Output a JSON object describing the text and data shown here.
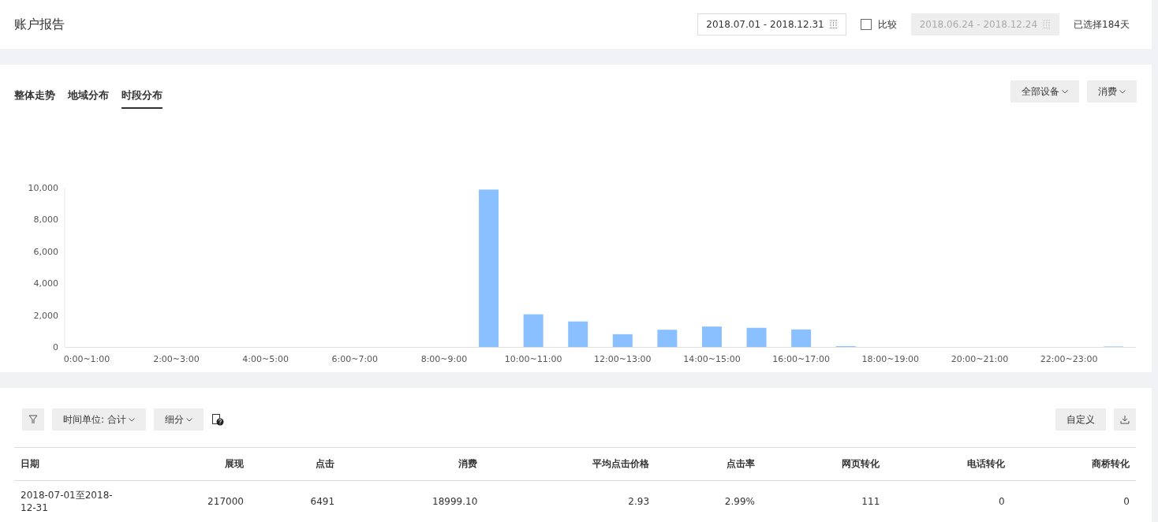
{
  "header": {
    "title": "账户报告",
    "date_range": "2018.07.01 - 2018.12.31",
    "compare": {
      "label": "比较",
      "checked": false
    },
    "compare_range": "2018.06.24 - 2018.12.24",
    "compare_disabled": true,
    "selected_days": "已选择184天"
  },
  "tabs": [
    {
      "label": "整体走势",
      "selected": false
    },
    {
      "label": "地域分布",
      "selected": false
    },
    {
      "label": "时段分布",
      "selected": true
    }
  ],
  "chart_filters": [
    "全部设备",
    "消费"
  ],
  "chart_data": {
    "type": "bar",
    "categories": [
      "0:00~1:00",
      null,
      "2:00~3:00",
      null,
      "4:00~5:00",
      null,
      "6:00~7:00",
      null,
      "8:00~9:00",
      null,
      "10:00~11:00",
      null,
      "12:00~13:00",
      null,
      "14:00~15:00",
      null,
      "16:00~17:00",
      null,
      "18:00~19:00",
      null,
      "20:00~21:00",
      null,
      "22:00~23:00",
      null
    ],
    "values": [
      0,
      0,
      0,
      0,
      0,
      0,
      0,
      0,
      0,
      9880,
      2050,
      1600,
      800,
      1080,
      1280,
      1200,
      1100,
      50,
      0,
      0,
      0,
      0,
      0,
      30
    ],
    "ylim": [
      0,
      10000
    ],
    "yticks": [
      {
        "value": 0,
        "label": "0"
      },
      {
        "value": 2000,
        "label": "2,000"
      },
      {
        "value": 4000,
        "label": "4,000"
      },
      {
        "value": 6000,
        "label": "6,000"
      },
      {
        "value": 8000,
        "label": "8,000"
      },
      {
        "value": 10000,
        "label": "10,000"
      }
    ]
  },
  "toolbar": {
    "time_unit": "时间单位: 合计",
    "breakdown": "细分",
    "customize": "自定义"
  },
  "table": {
    "columns": [
      "日期",
      "展现",
      "点击",
      "消费",
      "平均点击价格",
      "点击率",
      "网页转化",
      "电话转化",
      "商桥转化"
    ],
    "rows": [
      [
        "2018-07-01至2018-12-31",
        "217000",
        "6491",
        "18999.10",
        "2.93",
        "2.99%",
        "111",
        "0",
        "0"
      ]
    ]
  }
}
